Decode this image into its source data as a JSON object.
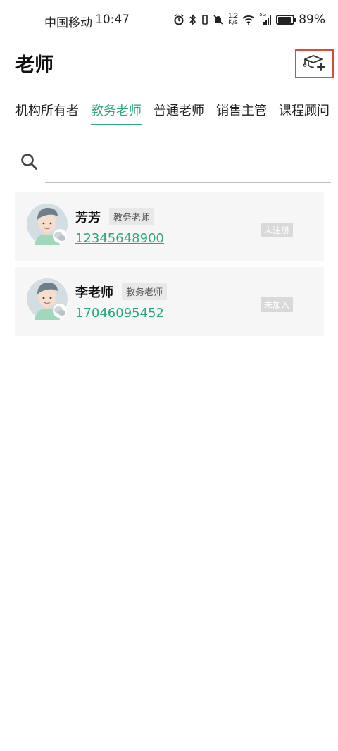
{
  "status_bar": {
    "carrier": "中国移动",
    "time": "10:47",
    "net_speed_value": "1.2",
    "net_speed_unit": "K/s",
    "network_type": "5G",
    "battery": "89%",
    "battery_level": 0.89
  },
  "header": {
    "title": "老师",
    "add_icon": "graduation-cap-plus-icon"
  },
  "tabs": [
    {
      "label": "机构所有者",
      "active": false
    },
    {
      "label": "教务老师",
      "active": true
    },
    {
      "label": "普通老师",
      "active": false
    },
    {
      "label": "销售主管",
      "active": false
    },
    {
      "label": "课程顾问",
      "active": false
    }
  ],
  "search": {
    "placeholder": "",
    "value": ""
  },
  "teachers": [
    {
      "name": "芳芳",
      "role": "教务老师",
      "phone": "12345648900",
      "status": "未注册"
    },
    {
      "name": "李老师",
      "role": "教务老师",
      "phone": "17046095452",
      "status": "未加入"
    }
  ],
  "colors": {
    "accent": "#2aa77d",
    "highlight_border": "#d94a38",
    "card_bg": "#f6f6f6",
    "badge_bg": "#e8e8e8",
    "status_tag_bg": "#d9d9d9"
  }
}
